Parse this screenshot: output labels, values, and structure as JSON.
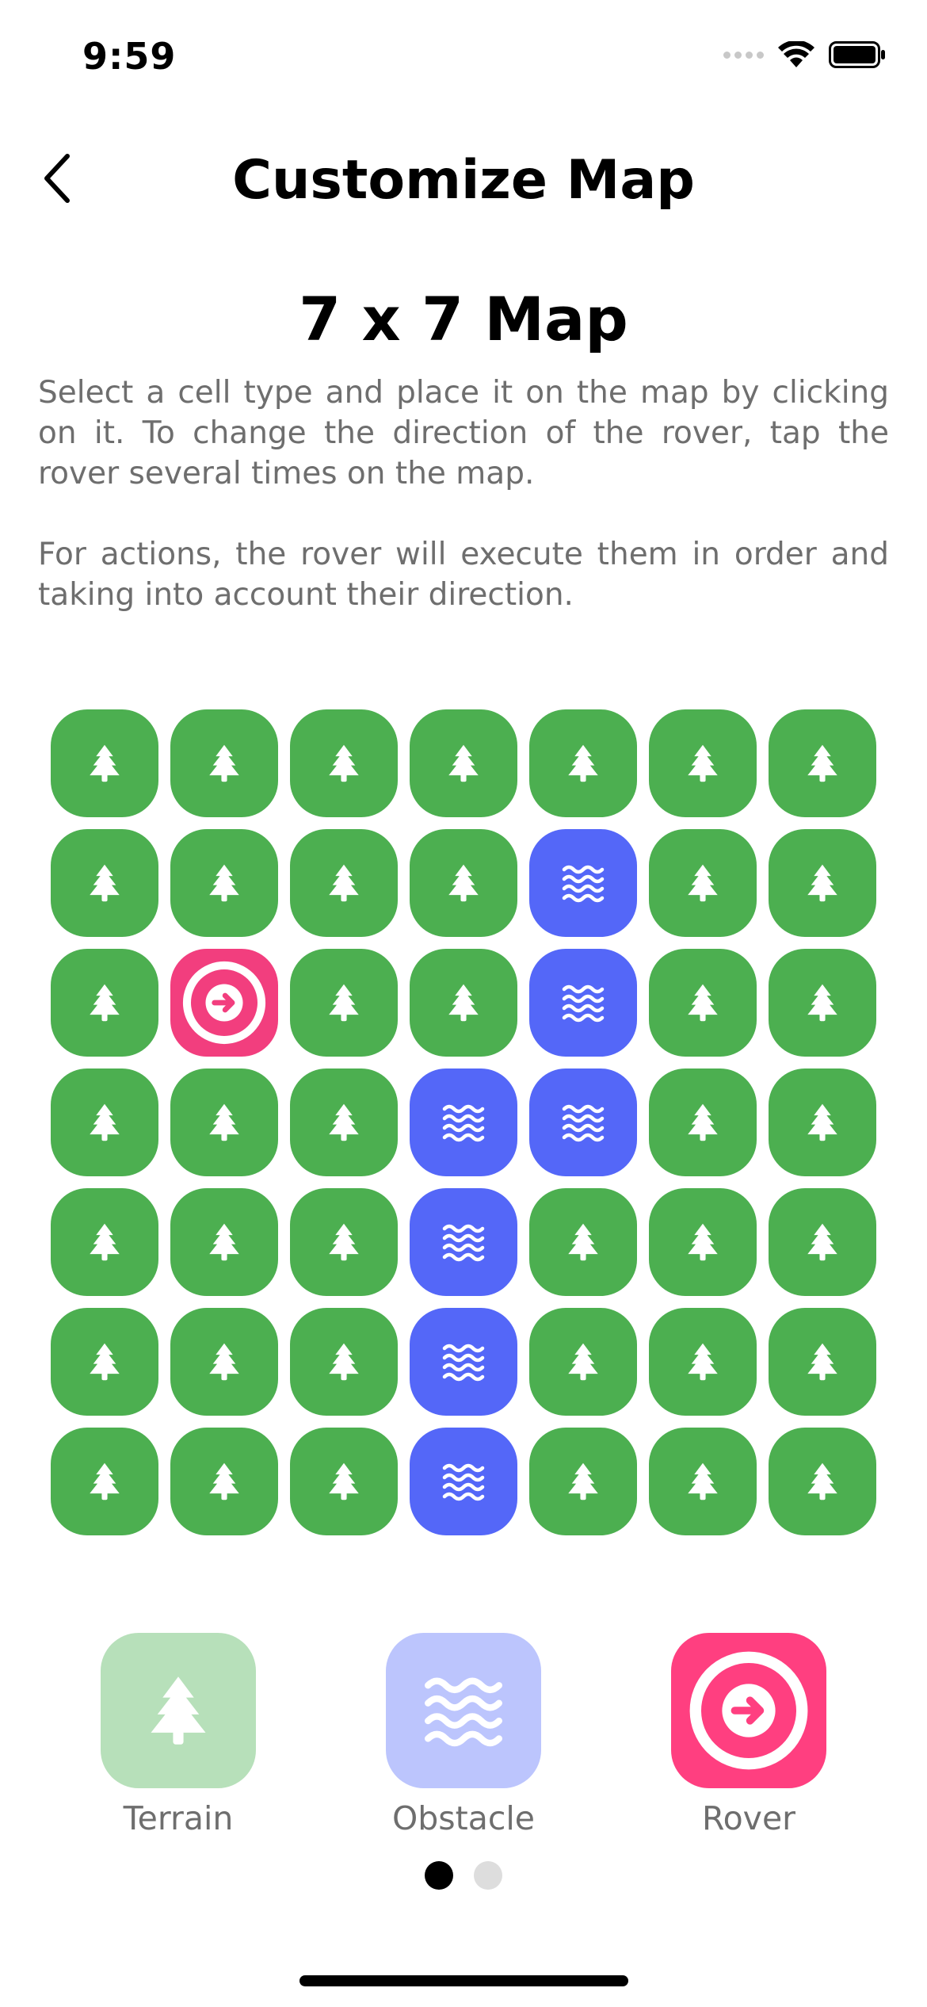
{
  "status_bar": {
    "time": "9:59"
  },
  "header": {
    "title": "Customize Map",
    "back_icon": "chevron-left-icon"
  },
  "map": {
    "title": "7 x 7 Map",
    "size": 7,
    "description": [
      "Select a cell type and place it on the map by clicking on it. To change the direction of the rover, tap the rover several times on the map.",
      "For actions, the rover will execute them in order and taking into account their direction."
    ],
    "rover_direction": "right",
    "grid": [
      [
        "terrain",
        "terrain",
        "terrain",
        "terrain",
        "terrain",
        "terrain",
        "terrain"
      ],
      [
        "terrain",
        "terrain",
        "terrain",
        "terrain",
        "obstacle",
        "terrain",
        "terrain"
      ],
      [
        "terrain",
        "rover",
        "terrain",
        "terrain",
        "obstacle",
        "terrain",
        "terrain"
      ],
      [
        "terrain",
        "terrain",
        "terrain",
        "obstacle",
        "obstacle",
        "terrain",
        "terrain"
      ],
      [
        "terrain",
        "terrain",
        "terrain",
        "obstacle",
        "terrain",
        "terrain",
        "terrain"
      ],
      [
        "terrain",
        "terrain",
        "terrain",
        "obstacle",
        "terrain",
        "terrain",
        "terrain"
      ],
      [
        "terrain",
        "terrain",
        "terrain",
        "obstacle",
        "terrain",
        "terrain",
        "terrain"
      ]
    ]
  },
  "cell_types": {
    "terrain": {
      "color": "#4CAF50",
      "icon": "tree-icon"
    },
    "obstacle": {
      "color": "#5467F8",
      "icon": "waves-icon"
    },
    "rover": {
      "color": "#F23E7E",
      "icon": "arrow-circle-icon"
    }
  },
  "palette": {
    "items": [
      {
        "label": "Terrain",
        "type": "terrain",
        "color": "#B7E0BA",
        "icon": "tree-icon"
      },
      {
        "label": "Obstacle",
        "type": "obstacle",
        "color": "#BCC5FD",
        "icon": "waves-icon"
      },
      {
        "label": "Rover",
        "type": "rover",
        "color": "#FF3F80",
        "icon": "arrow-circle-icon"
      }
    ]
  },
  "pager": {
    "pages": 2,
    "current": 1,
    "active_color": "#000000",
    "inactive_color": "#DDDDDD"
  }
}
